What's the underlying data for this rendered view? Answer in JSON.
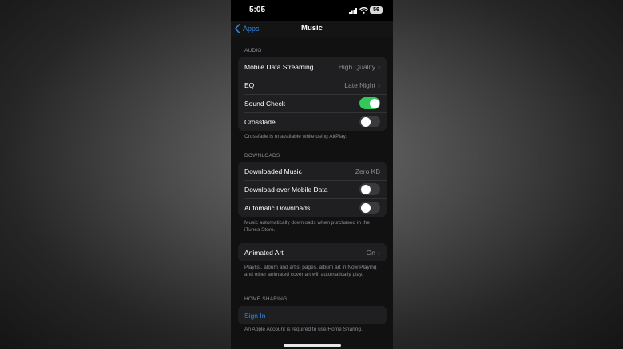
{
  "status_bar": {
    "time": "5:05",
    "battery": "56"
  },
  "nav": {
    "back_label": "Apps",
    "title": "Music"
  },
  "audio": {
    "header": "AUDIO",
    "mobile_streaming": {
      "label": "Mobile Data Streaming",
      "value": "High Quality"
    },
    "eq": {
      "label": "EQ",
      "value": "Late Night"
    },
    "sound_check": {
      "label": "Sound Check",
      "on": true
    },
    "crossfade": {
      "label": "Crossfade",
      "on": false
    },
    "footnote": "Crossfade is unavailable while using AirPlay."
  },
  "downloads": {
    "header": "DOWNLOADS",
    "downloaded_music": {
      "label": "Downloaded Music",
      "value": "Zero KB"
    },
    "over_mobile": {
      "label": "Download over Mobile Data",
      "on": false
    },
    "automatic": {
      "label": "Automatic Downloads",
      "on": false
    },
    "footnote": "Music automatically downloads when purchased in the iTunes Store."
  },
  "animated_art": {
    "label": "Animated Art",
    "value": "On",
    "footnote": "Playlist, album and artist pages, album art in Now Playing and other animated cover art will automatically play."
  },
  "home_sharing": {
    "header": "HOME SHARING",
    "sign_in": "Sign In",
    "footnote": "An Apple Account is required to use Home Sharing."
  },
  "colors": {
    "accent": "#2e86e0",
    "toggle_on": "#34c759",
    "toggle_off": "#3a3a3c",
    "background": "#000000",
    "cell": "#1f1f21"
  },
  "icons": {
    "back": "chevron-left-icon",
    "disclosure": "chevron-right-icon",
    "signal": "cellular-signal-icon",
    "wifi": "wifi-icon",
    "battery": "battery-icon"
  }
}
